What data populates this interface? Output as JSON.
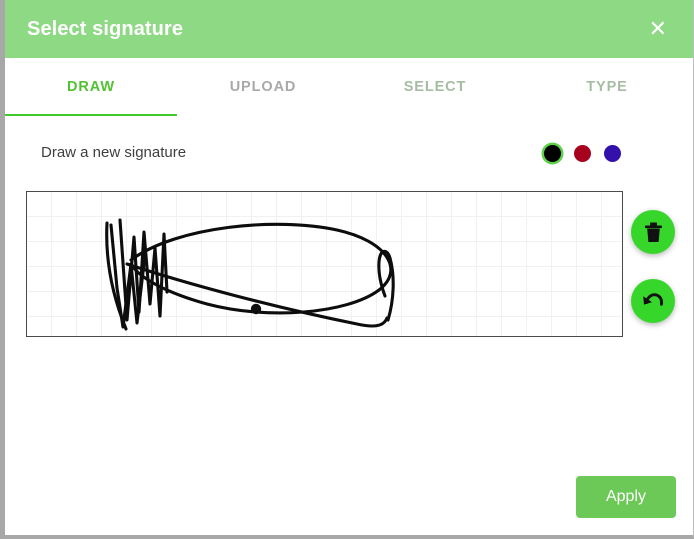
{
  "dialog": {
    "title": "Select signature",
    "close_icon": "close-icon"
  },
  "tabs": [
    {
      "label": "DRAW",
      "active": true
    },
    {
      "label": "UPLOAD",
      "active": false
    },
    {
      "label": "SELECT",
      "active": false
    },
    {
      "label": "TYPE",
      "active": false
    }
  ],
  "draw_panel": {
    "instruction": "Draw a new signature",
    "colors": [
      {
        "name": "color-swatch-black",
        "hex": "#000000",
        "selected": true
      },
      {
        "name": "color-swatch-red",
        "hex": "#a60220",
        "selected": false
      },
      {
        "name": "color-swatch-blue",
        "hex": "#3411ab",
        "selected": false
      }
    ],
    "selected_color": "#000000",
    "canvas": {
      "grid_size": 25,
      "grid_color": "#f1f1f1",
      "border_color": "#4a4a4a",
      "has_drawing": true
    },
    "tools": [
      {
        "name": "delete-button",
        "icon": "trash-icon",
        "label": "Clear"
      },
      {
        "name": "undo-button",
        "icon": "undo-icon",
        "label": "Undo"
      }
    ]
  },
  "footer": {
    "apply_label": "Apply"
  },
  "theme": {
    "header_green": "#8ed984",
    "active_tab_green": "#52c234",
    "underline_green": "#3fcc2b",
    "fab_green": "#37d62b",
    "apply_green": "#6cc857",
    "tab_inactive": "#a9a9a9",
    "tab_muted": "#a6bda3"
  }
}
